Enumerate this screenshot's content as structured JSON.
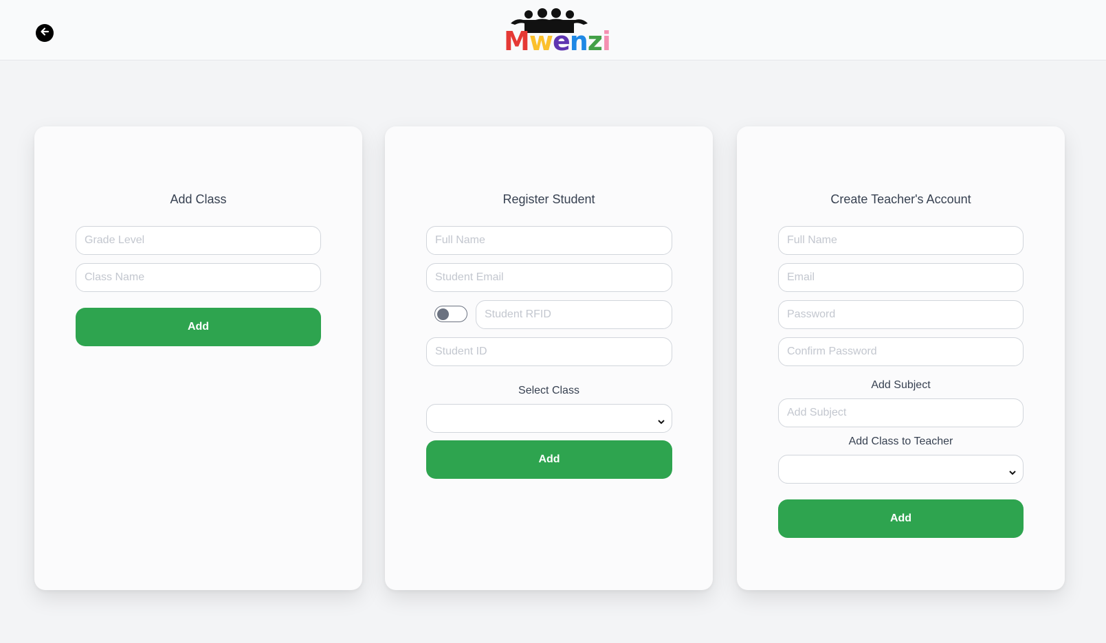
{
  "header": {
    "back_icon": "arrow-left-icon",
    "logo_text": "Mwenzi",
    "logo_letters": [
      {
        "ch": "M",
        "color": "#e53935"
      },
      {
        "ch": "w",
        "color": "#fbc02d"
      },
      {
        "ch": "e",
        "color": "#5e35b1"
      },
      {
        "ch": "n",
        "color": "#1e88e5"
      },
      {
        "ch": "z",
        "color": "#43a047"
      },
      {
        "ch": "i",
        "color": "#f48fb1"
      }
    ]
  },
  "add_class": {
    "title": "Add Class",
    "grade_level_placeholder": "Grade Level",
    "class_name_placeholder": "Class Name",
    "add_label": "Add"
  },
  "register_student": {
    "title": "Register Student",
    "full_name_placeholder": "Full Name",
    "email_placeholder": "Student Email",
    "rfid_placeholder": "Student RFID",
    "rfid_toggle_on": false,
    "student_id_placeholder": "Student ID",
    "select_class_label": "Select Class",
    "select_class_value": "",
    "add_label": "Add"
  },
  "create_teacher": {
    "title": "Create Teacher's Account",
    "full_name_placeholder": "Full Name",
    "email_placeholder": "Email",
    "password_placeholder": "Password",
    "confirm_password_placeholder": "Confirm Password",
    "add_subject_label": "Add Subject",
    "add_subject_placeholder": "Add Subject",
    "add_class_label": "Add Class to Teacher",
    "add_class_value": "",
    "add_label": "Add"
  },
  "colors": {
    "accent_green": "#2ea44f",
    "background": "#f3f4f6",
    "card": "#fbfbfc"
  }
}
